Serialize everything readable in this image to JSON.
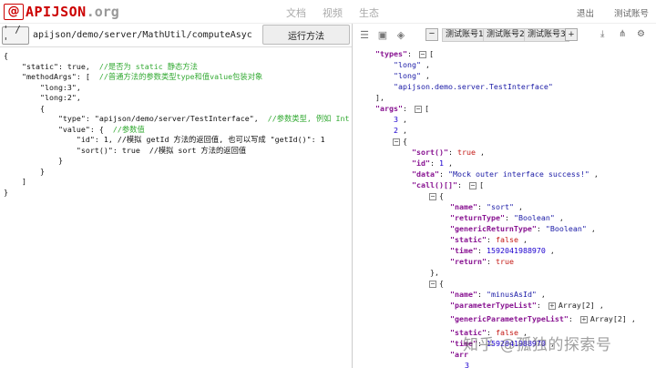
{
  "header": {
    "logo_symbol": "@",
    "logo_name": "APIJSON",
    "logo_ext": ".org",
    "nav": [
      "文档",
      "视频",
      "生态"
    ],
    "logout": "退出",
    "test_account": "测试账号"
  },
  "request": {
    "method": "' / '",
    "url": "apijson/demo/server/MathUtil/computeAsyc",
    "run_label": "运行方法"
  },
  "editor_lines": [
    {
      "code": "{",
      "comment": ""
    },
    {
      "code": "    \"static\": true,  ",
      "comment": "//是否为 static 静态方法"
    },
    {
      "code": "    \"methodArgs\": [  ",
      "comment": "//普通方法的参数类型type和值value包装对象"
    },
    {
      "code": "        \"long:3\",",
      "comment": ""
    },
    {
      "code": "        \"long:2\",",
      "comment": ""
    },
    {
      "code": "        {",
      "comment": ""
    },
    {
      "code": "            \"type\": \"apijson/demo/server/TestInterface\",  ",
      "comment": "//参数类型, 例如 Integer"
    },
    {
      "code": "            \"value\": {  ",
      "comment": "//参数值"
    },
    {
      "code": "                \"id\": 1, //模拟 getId 方法的返回值, 也可以写成 \"getId()\": 1",
      "comment": ""
    },
    {
      "code": "                \"sort()\": true  //模拟 sort 方法的返回值",
      "comment": ""
    },
    {
      "code": "            }",
      "comment": ""
    },
    {
      "code": "        }",
      "comment": ""
    },
    {
      "code": "    ]",
      "comment": ""
    },
    {
      "code": "}",
      "comment": ""
    }
  ],
  "toolbar": {
    "accounts": [
      "测试账号1",
      "测试账号2",
      "测试账号3"
    ],
    "minus": "−",
    "plus": "+"
  },
  "response": {
    "types_key": "\"types\"",
    "types_values": [
      "\"long\"",
      "\"long\"",
      "\"apijson.demo.server.TestInterface\""
    ],
    "args_key": "\"args\"",
    "args_num1": "3",
    "args_num2": "2",
    "sort_key": "\"sort()\"",
    "sort_val": "true",
    "id_key": "\"id\"",
    "id_val": "1",
    "data_key": "\"data\"",
    "data_val": "\"Mock outer interface success!\"",
    "call_key": "\"call()[]\"",
    "call1": {
      "name": "\"sort\"",
      "returnType": "\"Boolean\"",
      "genericReturnType": "\"Boolean\"",
      "static": "false",
      "time": "1592041988970",
      "return": "true"
    },
    "call2": {
      "name": "\"minusAsId\"",
      "parameterTypeList": "Array[2]",
      "genericParameterTypeList": "Array[2]",
      "static": "false",
      "time": "1592041988970",
      "partial_key": "\"arr",
      "partial_val": "3"
    }
  },
  "watermark": "知乎 @孤独的探索号"
}
